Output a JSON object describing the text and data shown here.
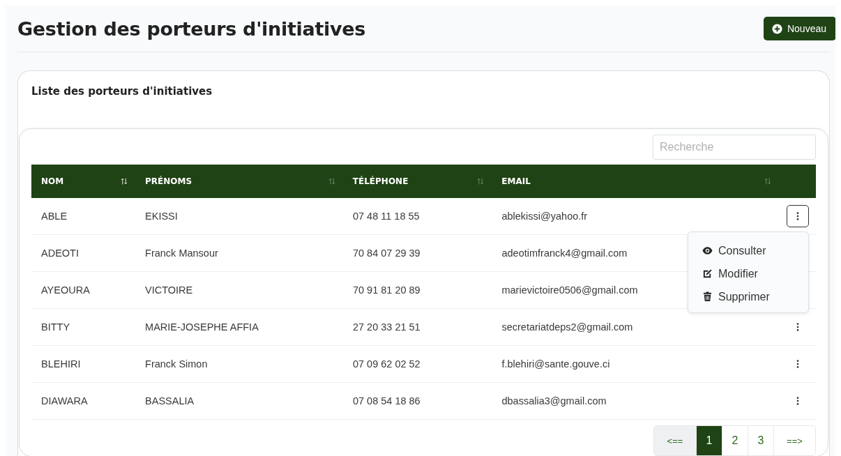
{
  "page": {
    "title": "Gestion des porteurs d'initiatives",
    "new_button": "Nouveau"
  },
  "card": {
    "title": "Liste des porteurs d'initiatives"
  },
  "search": {
    "placeholder": "Recherche"
  },
  "table": {
    "columns": [
      {
        "label": "NOM",
        "sorted": true
      },
      {
        "label": "PRÉNOMS",
        "sorted": false
      },
      {
        "label": "TÉLÉPHONE",
        "sorted": false
      },
      {
        "label": "EMAIL",
        "sorted": false
      }
    ],
    "rows": [
      {
        "cells": [
          "ABLE",
          "EKISSI",
          "07 48 11 18 55",
          "ablekissi@yahoo.fr"
        ],
        "menu_open": true
      },
      {
        "cells": [
          "ADEOTI",
          "Franck Mansour",
          "70 84 07 29 39",
          "adeotimfranck4@gmail.com"
        ],
        "menu_open": false
      },
      {
        "cells": [
          "AYEOURA",
          "VICTOIRE",
          "70 91 81 20 89",
          "marievictoire0506@gmail.com"
        ],
        "menu_open": false
      },
      {
        "cells": [
          "BITTY",
          "MARIE-JOSEPHE AFFIA",
          "27 20 33 21 51",
          "secretariatdeps2@gmail.com"
        ],
        "menu_open": false
      },
      {
        "cells": [
          "BLEHIRI",
          "Franck Simon",
          "07 09 62 02 52",
          "f.blehiri@sante.gouve.ci"
        ],
        "menu_open": false
      },
      {
        "cells": [
          "DIAWARA",
          "BASSALIA",
          "07 08 54 18 86",
          "dbassalia3@gmail.com"
        ],
        "menu_open": false
      }
    ]
  },
  "menu": {
    "items": [
      {
        "kind": "view",
        "label": "Consulter"
      },
      {
        "kind": "edit",
        "label": "Modifier"
      },
      {
        "kind": "delete",
        "label": "Supprimer"
      }
    ]
  },
  "pagination": {
    "prev": {
      "label": "<==",
      "disabled": true
    },
    "pages": [
      {
        "label": "1",
        "selected": true
      },
      {
        "label": "2",
        "selected": false
      },
      {
        "label": "3",
        "selected": false
      }
    ],
    "next": {
      "label": "==>",
      "disabled": false
    }
  }
}
